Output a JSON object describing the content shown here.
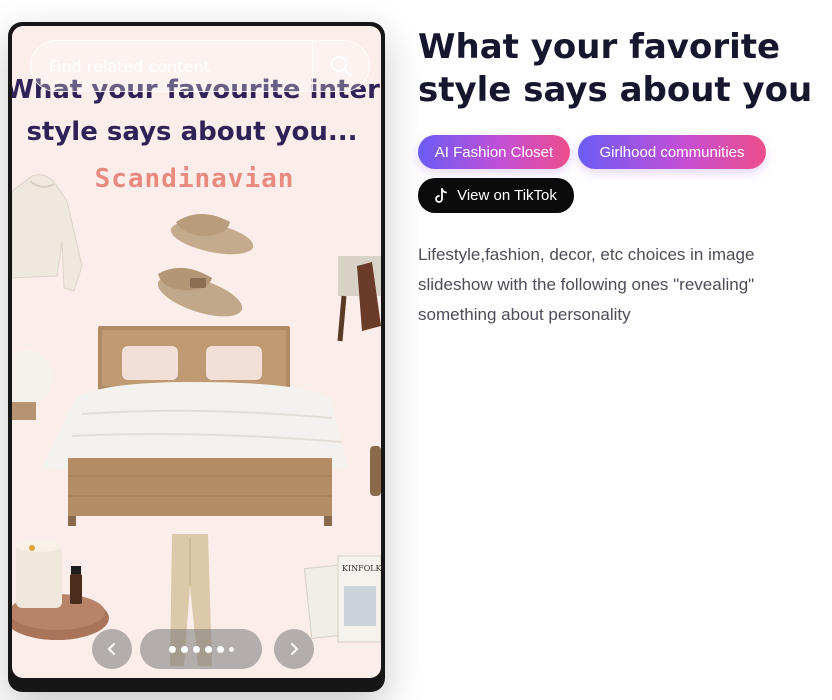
{
  "slideshow": {
    "search_placeholder": "Find related content",
    "slide_title_line1": "What your favourite interi",
    "slide_title_line2": "style says about you...",
    "slide_subtitle": "Scandinavian",
    "prev_icon": "chevron-left-icon",
    "next_icon": "chevron-right-icon",
    "dots_count": 6
  },
  "post": {
    "title": "What your favorite style says about you",
    "tags": [
      "AI Fashion Closet",
      "Girlhood communities"
    ],
    "tiktok_label": "View on TikTok",
    "description": "Lifestyle,fashion, decor, etc choices in image slideshow with the following ones \"revealing\" something about personality"
  },
  "colors": {
    "accent_gradient_start": "#6b5cf6",
    "accent_gradient_end": "#ee4d8b",
    "slide_background": "#fbeeea",
    "slide_title": "#2e2257",
    "slide_subtitle": "#e88a80"
  }
}
